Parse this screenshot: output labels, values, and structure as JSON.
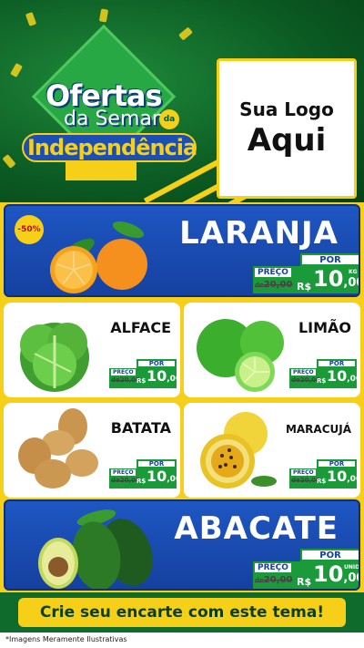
{
  "header": {
    "title_line1": "Ofertas",
    "title_line2": "da Semana",
    "title_de": "da",
    "title_line3": "Independência",
    "logo_line1": "Sua Logo",
    "logo_line2": "Aqui"
  },
  "products": {
    "laranja": {
      "name": "LARANJA",
      "discount": "-50%",
      "por": "POR",
      "preco": "PREÇO",
      "old_prefix": "de",
      "old": "20,00",
      "currency": "R$",
      "value_int": "10",
      "value_dec": ",00",
      "unit": "KG"
    },
    "alface": {
      "name": "ALFACE",
      "por": "POR",
      "preco": "PREÇO",
      "old_prefix": "de",
      "old": "20,00",
      "currency": "R$",
      "value_int": "10",
      "value_dec": ",00",
      "unit": "KG"
    },
    "limao": {
      "name": "LIMÃO",
      "por": "POR",
      "preco": "PREÇO",
      "old_prefix": "de",
      "old": "20,00",
      "currency": "R$",
      "value_int": "10",
      "value_dec": ",00",
      "unit": "KG"
    },
    "batata": {
      "name": "BATATA",
      "por": "POR",
      "preco": "PREÇO",
      "old_prefix": "de",
      "old": "20,00",
      "currency": "R$",
      "value_int": "10",
      "value_dec": ",00",
      "unit": "KG"
    },
    "maracuja": {
      "name": "MARACUJÁ",
      "por": "POR",
      "preco": "PREÇO",
      "old_prefix": "de",
      "old": "20,00",
      "currency": "R$",
      "value_int": "10",
      "value_dec": ",00",
      "unit": "KG"
    },
    "abacate": {
      "name": "ABACATE",
      "por": "POR",
      "preco": "PREÇO",
      "old_prefix": "de",
      "old": "20,00",
      "currency": "R$",
      "value_int": "10",
      "value_dec": ",00",
      "unit": "UNID"
    }
  },
  "cta": "Crie seu encarte com este tema!",
  "footnote": "*Imagens Meramente Ilustrativas",
  "colors": {
    "green": "#0e6b2c",
    "yellow": "#f5cf18",
    "blue": "#1e56c2",
    "price_green": "#1b9a3a"
  }
}
